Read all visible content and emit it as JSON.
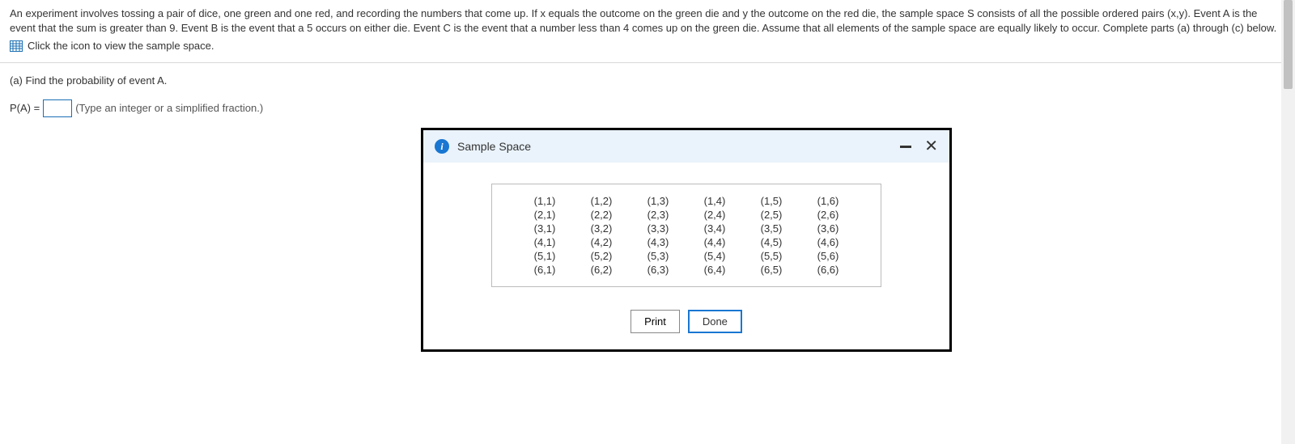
{
  "question": {
    "main_text": "An experiment involves tossing a pair of dice, one green and one red, and recording the numbers that come up. If x equals the outcome on the green die and y the outcome on the red die, the sample space S consists of all the possible ordered pairs (x,y). Event A is the event that the sum is greater than 9. Event B is the event that a 5 occurs on either die. Event C is the event that a number less than 4 comes up on the green die. Assume that all elements of the sample space are equally likely to occur. Complete parts (a) through (c) below.",
    "sample_link_text": "Click the icon to view the sample space.",
    "part_a_label": "(a) Find the probability of event A.",
    "answer_prefix": "P(A) =",
    "answer_value": "",
    "answer_hint": "(Type an integer or a simplified fraction.)"
  },
  "modal": {
    "title": "Sample Space",
    "info_glyph": "i",
    "close_glyph": "✕",
    "print_label": "Print",
    "done_label": "Done",
    "rows": [
      [
        "(1,1)",
        "(1,2)",
        "(1,3)",
        "(1,4)",
        "(1,5)",
        "(1,6)"
      ],
      [
        "(2,1)",
        "(2,2)",
        "(2,3)",
        "(2,4)",
        "(2,5)",
        "(2,6)"
      ],
      [
        "(3,1)",
        "(3,2)",
        "(3,3)",
        "(3,4)",
        "(3,5)",
        "(3,6)"
      ],
      [
        "(4,1)",
        "(4,2)",
        "(4,3)",
        "(4,4)",
        "(4,5)",
        "(4,6)"
      ],
      [
        "(5,1)",
        "(5,2)",
        "(5,3)",
        "(5,4)",
        "(5,5)",
        "(5,6)"
      ],
      [
        "(6,1)",
        "(6,2)",
        "(6,3)",
        "(6,4)",
        "(6,5)",
        "(6,6)"
      ]
    ]
  }
}
